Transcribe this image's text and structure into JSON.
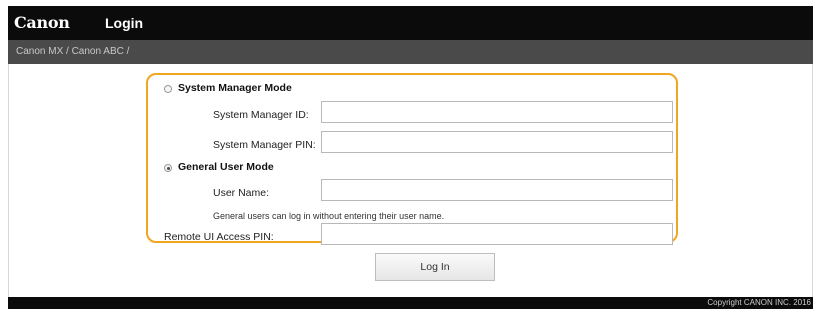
{
  "header": {
    "logo_text": "Canon",
    "title": "Login"
  },
  "breadcrumb": {
    "text": "Canon MX / Canon ABC /"
  },
  "form": {
    "system_manager_mode": {
      "label": "System Manager Mode",
      "selected": false,
      "id_label": "System Manager ID:",
      "id_value": "",
      "pin_label": "System Manager PIN:",
      "pin_value": ""
    },
    "general_user_mode": {
      "label": "General User Mode",
      "selected": true,
      "user_name_label": "User Name:",
      "user_name_value": "",
      "note": "General users can log in without entering their user name."
    },
    "remote_ui_pin_label": "Remote UI Access PIN:",
    "remote_ui_pin_value": ""
  },
  "login_button": "Log In",
  "footer": {
    "copyright": "Copyright CANON INC. 2016"
  },
  "colors": {
    "topbar": "#0b0b0b",
    "breadcrumb_bar": "#4a4a4a",
    "panel_border": "#f2a51f"
  }
}
